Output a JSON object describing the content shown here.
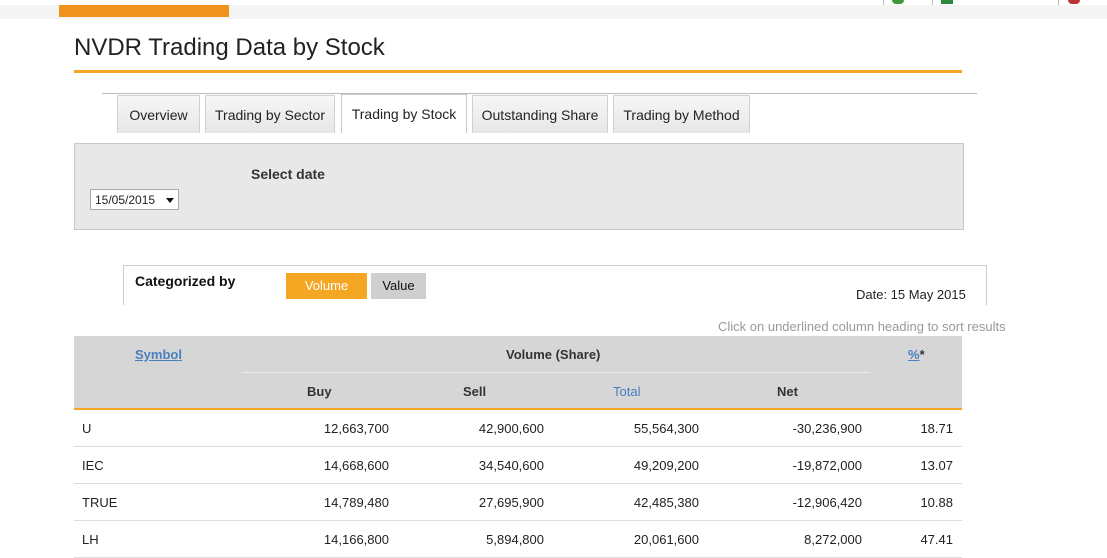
{
  "page": {
    "title": "NVDR Trading Data by Stock"
  },
  "tabs": [
    {
      "label": "Overview",
      "active": false
    },
    {
      "label": "Trading by Sector",
      "active": false
    },
    {
      "label": "Trading by Stock",
      "active": true
    },
    {
      "label": "Outstanding Share",
      "active": false
    },
    {
      "label": "Trading by Method",
      "active": false
    }
  ],
  "filter": {
    "select_label": "Select date",
    "selected_date": "15/05/2015"
  },
  "categorized": {
    "label": "Categorized by",
    "volume_label": "Volume",
    "value_label": "Value",
    "active": "Volume",
    "date_text": "Date: 15 May 2015"
  },
  "sort_hint": "Click on underlined column heading to sort results",
  "table": {
    "symbol_header": "Symbol",
    "group_header": "Volume (Share)",
    "percent_header": "%",
    "percent_suffix": "*",
    "columns": {
      "buy": "Buy",
      "sell": "Sell",
      "total": "Total",
      "net": "Net"
    },
    "rows": [
      {
        "symbol": "U",
        "buy": "12,663,700",
        "sell": "42,900,600",
        "total": "55,564,300",
        "net": "-30,236,900",
        "pct": "18.71"
      },
      {
        "symbol": "IEC",
        "buy": "14,668,600",
        "sell": "34,540,600",
        "total": "49,209,200",
        "net": "-19,872,000",
        "pct": "13.07"
      },
      {
        "symbol": "TRUE",
        "buy": "14,789,480",
        "sell": "27,695,900",
        "total": "42,485,380",
        "net": "-12,906,420",
        "pct": "10.88"
      },
      {
        "symbol": "LH",
        "buy": "14,166,800",
        "sell": "5,894,800",
        "total": "20,061,600",
        "net": "8,272,000",
        "pct": "47.41"
      }
    ]
  },
  "colors": {
    "accent": "#f5a623",
    "link": "#4a7fbf"
  }
}
